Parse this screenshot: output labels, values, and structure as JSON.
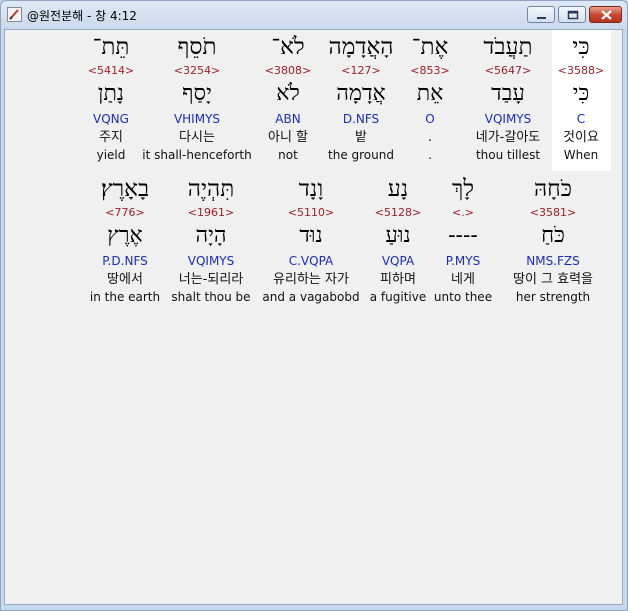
{
  "window": {
    "title": "@원전분해 - 창 4:12",
    "minimize_label": "minimize",
    "maximize_label": "maximize",
    "close_label": "close"
  },
  "colors": {
    "strong_number": "#a0202a",
    "parsing": "#1a2cc0",
    "selected_bg": "#ffffff"
  },
  "rows": [
    {
      "words": [
        {
          "hebrew": "כִּי",
          "strong": "<3588>",
          "lemma": "כִּי",
          "parsing": "C",
          "korean": "것이요",
          "english": "When",
          "selected": true
        },
        {
          "hebrew": "תַעֲבֹד",
          "strong": "<5647>",
          "lemma": "עָבַד",
          "parsing": "VQIMYS",
          "korean": "네가-갈아도",
          "english": "thou tillest",
          "selected": false
        },
        {
          "hebrew": "אֶת־",
          "strong": "<853>",
          "lemma": "אֵת",
          "parsing": "O",
          "korean": ".",
          "english": ".",
          "selected": false
        },
        {
          "hebrew": "הָאֲדָמָה",
          "strong": "<127>",
          "lemma": "אֲדָמָה",
          "parsing": "D.NFS",
          "korean": "밭",
          "english": "the ground",
          "selected": false
        },
        {
          "hebrew": "לֹא־",
          "strong": "<3808>",
          "lemma": "לֹא",
          "parsing": "ABN",
          "korean": "아니 할",
          "english": "not",
          "selected": false
        },
        {
          "hebrew": "תֹסֵף",
          "strong": "<3254>",
          "lemma": "יָסַף",
          "parsing": "VHIMYS",
          "korean": "다시는",
          "english": "it shall-henceforth",
          "selected": false
        },
        {
          "hebrew": "תֵּת־",
          "strong": "<5414>",
          "lemma": "נָתַן",
          "parsing": "VQNG",
          "korean": "주지",
          "english": "yield",
          "selected": false
        }
      ]
    },
    {
      "words": [
        {
          "hebrew": "כֹּחָהּ",
          "strong": "<3581>",
          "lemma": "כֹּחַ",
          "parsing": "NMS.FZS",
          "korean": "땅이 그 효력을",
          "english": "her strength",
          "selected": false
        },
        {
          "hebrew": "לָךְ",
          "strong": "<.>",
          "lemma": "----",
          "parsing": "P.MYS",
          "korean": "네게",
          "english": "unto thee",
          "selected": false
        },
        {
          "hebrew": "נָע",
          "strong": "<5128>",
          "lemma": "נוּעַ",
          "parsing": "VQPA",
          "korean": "피하며",
          "english": "a fugitive",
          "selected": false
        },
        {
          "hebrew": "וָנָד",
          "strong": "<5110>",
          "lemma": "נוּד",
          "parsing": "C.VQPA",
          "korean": "유리하는 자가",
          "english": "and a vagabobd",
          "selected": false
        },
        {
          "hebrew": "תִּהְיֶה",
          "strong": "<1961>",
          "lemma": "הָיָה",
          "parsing": "VQIMYS",
          "korean": "너는-되리라",
          "english": "shalt thou be",
          "selected": false
        },
        {
          "hebrew": "בָאָרֶץ׃",
          "strong": "<776>",
          "lemma": "אֶרֶץ",
          "parsing": "P.D.NFS",
          "korean": "땅에서",
          "english": "in the earth",
          "selected": false
        }
      ]
    }
  ]
}
